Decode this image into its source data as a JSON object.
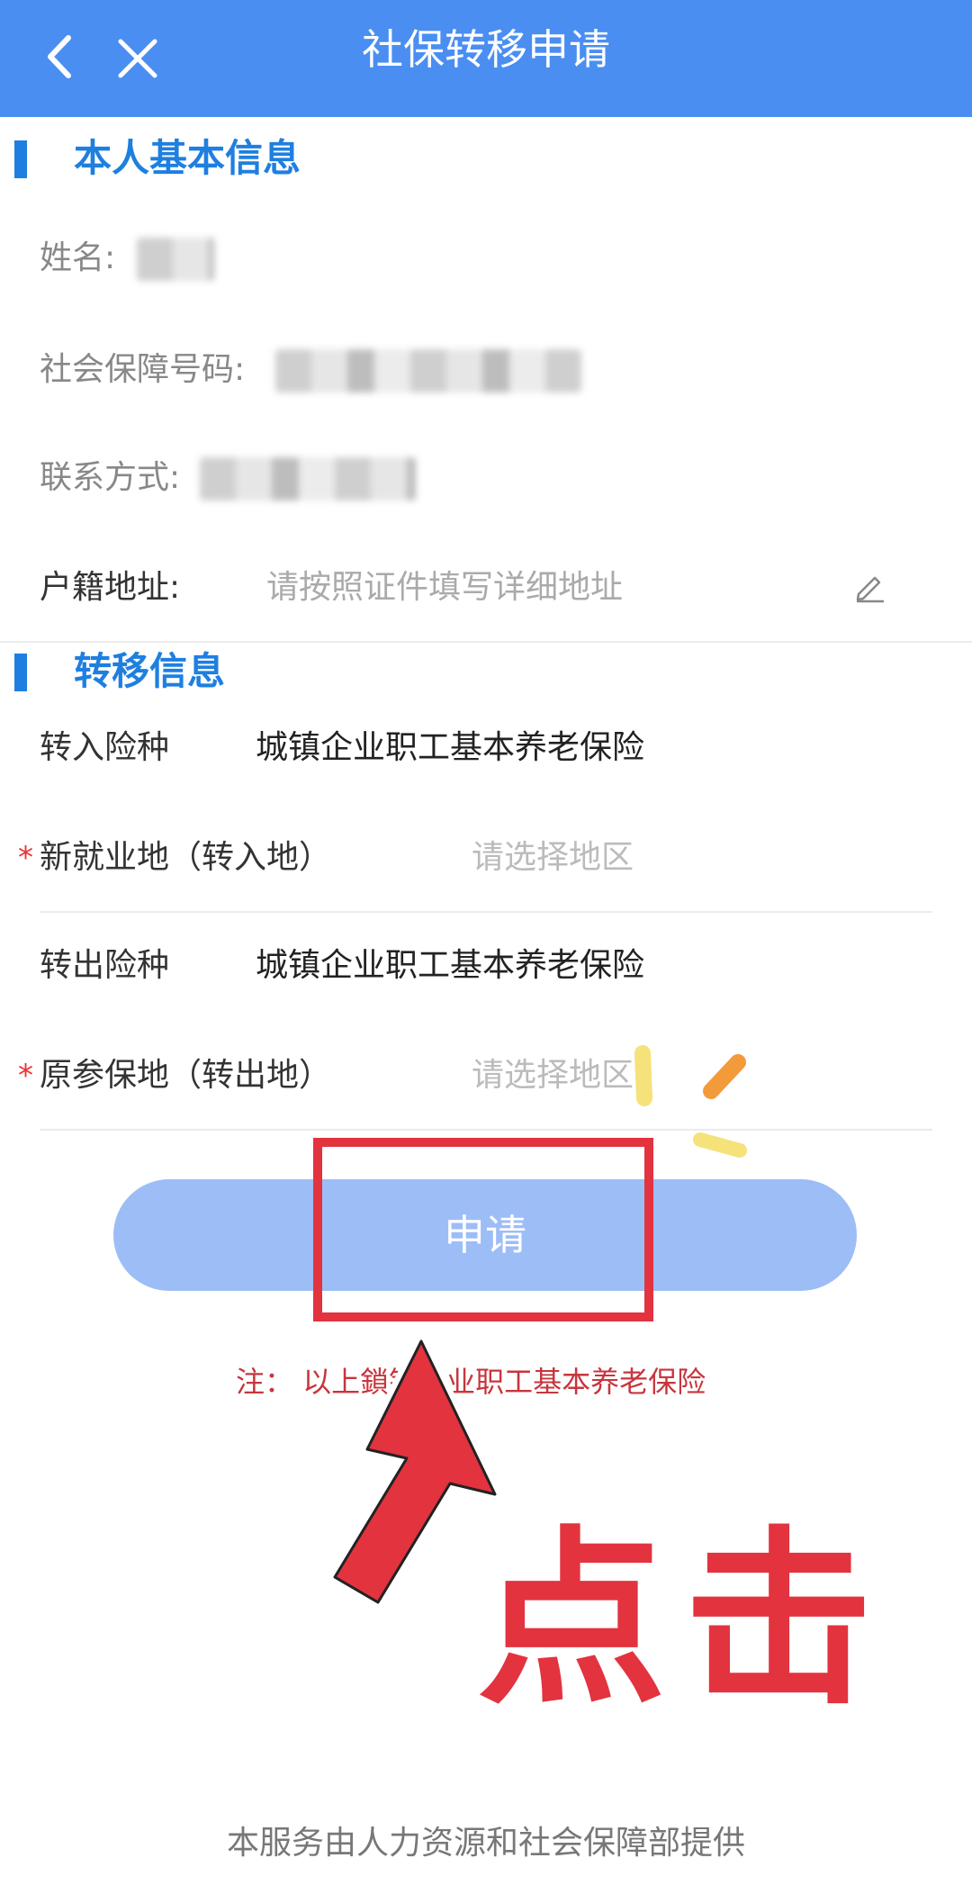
{
  "nav": {
    "title": "社保转移申请"
  },
  "basic": {
    "title": "本人基本信息",
    "name_label": "姓名:",
    "ssn_label": "社会保障号码:",
    "contact_label": "联系方式:",
    "address_label": "户籍地址:",
    "address_placeholder": "请按照证件填写详细地址"
  },
  "transfer": {
    "title": "转移信息",
    "in_type_label": "转入险种",
    "in_type_value": "城镇企业职工基本养老保险",
    "new_place_label": "新就业地（转入地）",
    "new_place_placeholder": "请选择地区",
    "out_type_label": "转出险种",
    "out_type_value": "城镇企业职工基本养老保险",
    "orig_place_label": "原参保地（转出地）",
    "orig_place_placeholder": "请选择地区",
    "required_mark": "*"
  },
  "apply": {
    "label": "申请"
  },
  "note": "注：  以上鎖镇企业职工基本养老保险",
  "overlay": {
    "click_text": "点击"
  },
  "footer": "本服务由人力资源和社会保障部提供",
  "colors": {
    "nav_bg": "#4a8ef2",
    "accent": "#1e7fe0",
    "highlight": "#e2333f"
  },
  "icons": [
    "back-icon",
    "close-icon",
    "edit-icon",
    "arrow-icon",
    "sparkle-icon"
  ]
}
